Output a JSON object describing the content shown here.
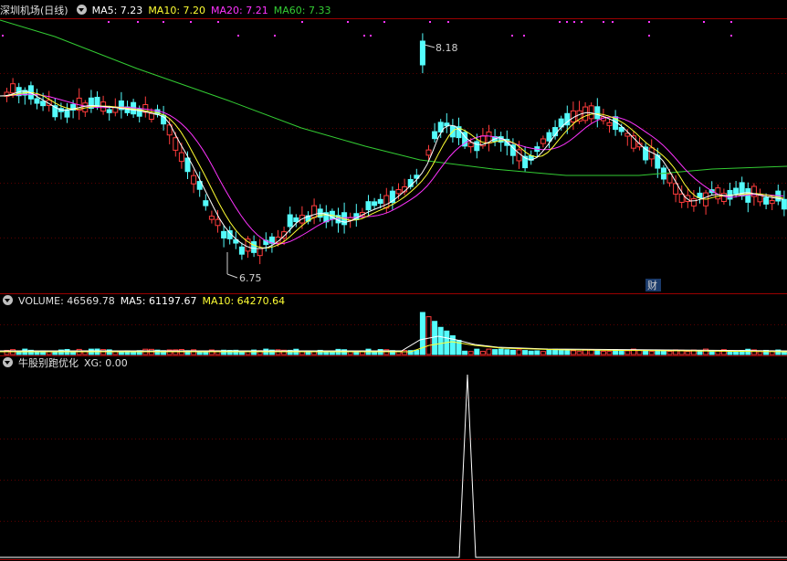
{
  "main_legend": {
    "title": "深圳机场(日线)",
    "ma5": "MA5: 7.23",
    "ma10": "MA10: 7.20",
    "ma20": "MA20: 7.21",
    "ma60": "MA60: 7.33"
  },
  "volume_legend": {
    "title": "VOLUME: 46569.78",
    "ma5": "MA5: 61197.67",
    "ma10": "MA10: 64270.64"
  },
  "indicator_legend": {
    "title": "牛股别跑优化",
    "xg": "XG: 0.00"
  },
  "annotations": {
    "high": "8.18",
    "low": "6.75",
    "finance_marker": "财"
  },
  "colors": {
    "up": "#ff3c3c",
    "down": "#54fcfc",
    "ma5": "#ffffff",
    "ma10": "#ffff33",
    "ma20": "#ff33ff",
    "ma60": "#33cc33",
    "border": "#9a0000"
  }
}
